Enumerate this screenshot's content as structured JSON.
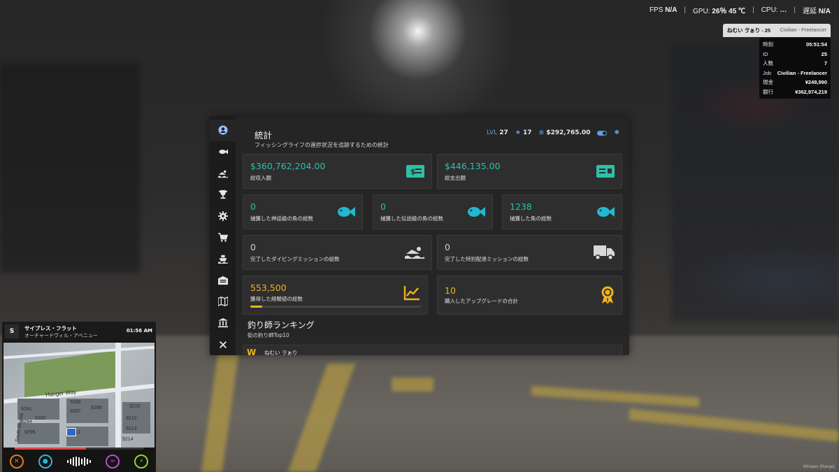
{
  "hud": {
    "fps_label": "FPS",
    "fps_value": "N/A",
    "gpu_label": "GPU:",
    "gpu_value": "26％ 45 ℃",
    "cpu_label": "CPU:",
    "cpu_value": "…",
    "delay_label": "遅延",
    "delay_value": "N/A"
  },
  "player": {
    "name": "ねむい ゔぁり - 25",
    "job": "Civilian - Freelancer",
    "info": [
      {
        "label": "時刻",
        "value": "05:51:54"
      },
      {
        "label": "ID",
        "value": "25"
      },
      {
        "label": "人数",
        "value": "7"
      },
      {
        "label": "Job",
        "value": "Civilian - Freelancer"
      },
      {
        "label": "現金",
        "value": "¥248,990"
      },
      {
        "label": "銀行",
        "value": "¥362,974,219"
      }
    ]
  },
  "panel": {
    "title": "統計",
    "subtitle": "フィッシングライフの進捗状況を追跡するための統計",
    "lvl_label": "LVL",
    "lvl_value": "27",
    "stars": "17",
    "money": "$292,765.00",
    "sidebar": [
      {
        "name": "user-icon"
      },
      {
        "name": "fish-icon"
      },
      {
        "name": "swimmer-icon"
      },
      {
        "name": "trophy-icon"
      },
      {
        "name": "gear-icon"
      },
      {
        "name": "cart-icon"
      },
      {
        "name": "ship-icon"
      },
      {
        "name": "warehouse-icon"
      },
      {
        "name": "map-icon"
      },
      {
        "name": "bank-icon"
      },
      {
        "name": "close-icon"
      }
    ],
    "cards": {
      "income": {
        "value": "$360,762,204.00",
        "label": "総収入額",
        "icon": "money-icon"
      },
      "expense": {
        "value": "$446,135.00",
        "label": "総支出額",
        "icon": "card-icon"
      },
      "mythic": {
        "value": "0",
        "label": "捕獲した神話級の魚の総数",
        "icon": "fish-icon"
      },
      "legendary": {
        "value": "0",
        "label": "捕獲した伝説級の魚の総数",
        "icon": "fish-icon"
      },
      "fish": {
        "value": "1238",
        "label": "捕獲した魚の総数",
        "icon": "fish-icon"
      },
      "diving": {
        "value": "0",
        "label": "完了したダイビングミッションの総数",
        "icon": "swimmer-icon"
      },
      "delivery": {
        "value": "0",
        "label": "完了した特別配達ミッションの総数",
        "icon": "truck-icon"
      },
      "xp": {
        "value": "553,500",
        "label": "獲得した経験値の総数",
        "icon": "chart-icon",
        "progress": 0.07
      },
      "upgrades": {
        "value": "10",
        "label": "購入したアップグレードの合計",
        "icon": "award-icon"
      }
    },
    "ranking_title": "釣り師ランキング",
    "ranking_sub": "街の釣り師Top10",
    "ranking_first": "ねむい ゔぁり"
  },
  "minimap": {
    "direction": "S",
    "street": "サイプレス・フラット",
    "area": "オーチャードヴィル・アベニュー",
    "time": "01:56 AM",
    "labels": [
      "Hanger Way",
      "South Shamb",
      "9288",
      "9287",
      "9289",
      "9210",
      "9291",
      "9292",
      "9294",
      "9213",
      "9212",
      "9211",
      "9214",
      "9296"
    ],
    "health": 0.55
  },
  "watermark": "Whisper (Range)"
}
